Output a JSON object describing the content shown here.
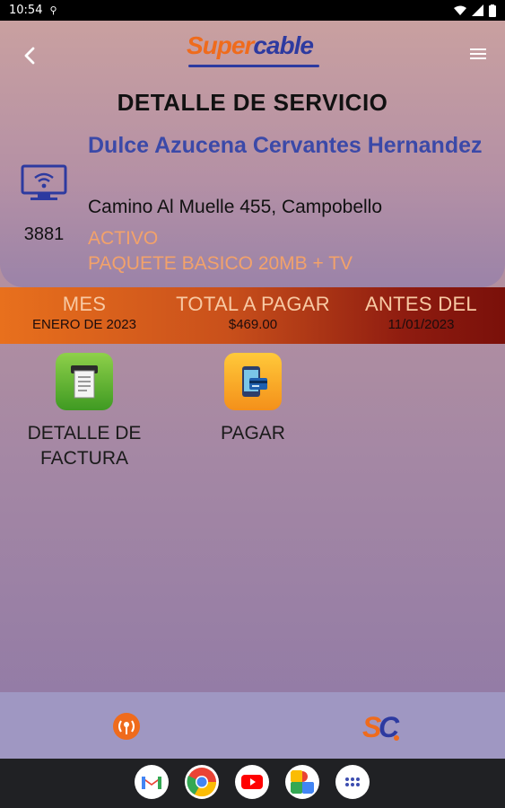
{
  "status_bar": {
    "time": "10:54"
  },
  "header": {
    "logo_super": "Super",
    "logo_cable": "cable",
    "title": "DETALLE DE SERVICIO"
  },
  "customer": {
    "name": "Dulce Azucena Cervantes Hernandez",
    "address": "Camino Al Muelle 455, Campobello",
    "account_number": "3881",
    "status": "ACTIVO",
    "package": "PAQUETE BASICO 20MB + TV"
  },
  "summary": {
    "month_label": "MES",
    "month_value": "ENERO DE 2023",
    "total_label": "TOTAL A PAGAR",
    "total_value": "$469.00",
    "due_label": "ANTES DEL",
    "due_value": "11/01/2023"
  },
  "actions": {
    "invoice_label_line1": "DETALLE DE",
    "invoice_label_line2": "FACTURA",
    "pay_label": "PAGAR"
  },
  "colors": {
    "accent_orange": "#ef6b1c",
    "brand_blue": "#2d3aa0",
    "name_blue": "#3b49a8",
    "status_orange": "#f3a26a"
  },
  "icons": {
    "tv": "tv-wifi-icon",
    "invoice": "receipt-icon",
    "pay": "phone-card-icon",
    "nav_left": "antenna-icon",
    "nav_right": "sc-logo-icon"
  }
}
